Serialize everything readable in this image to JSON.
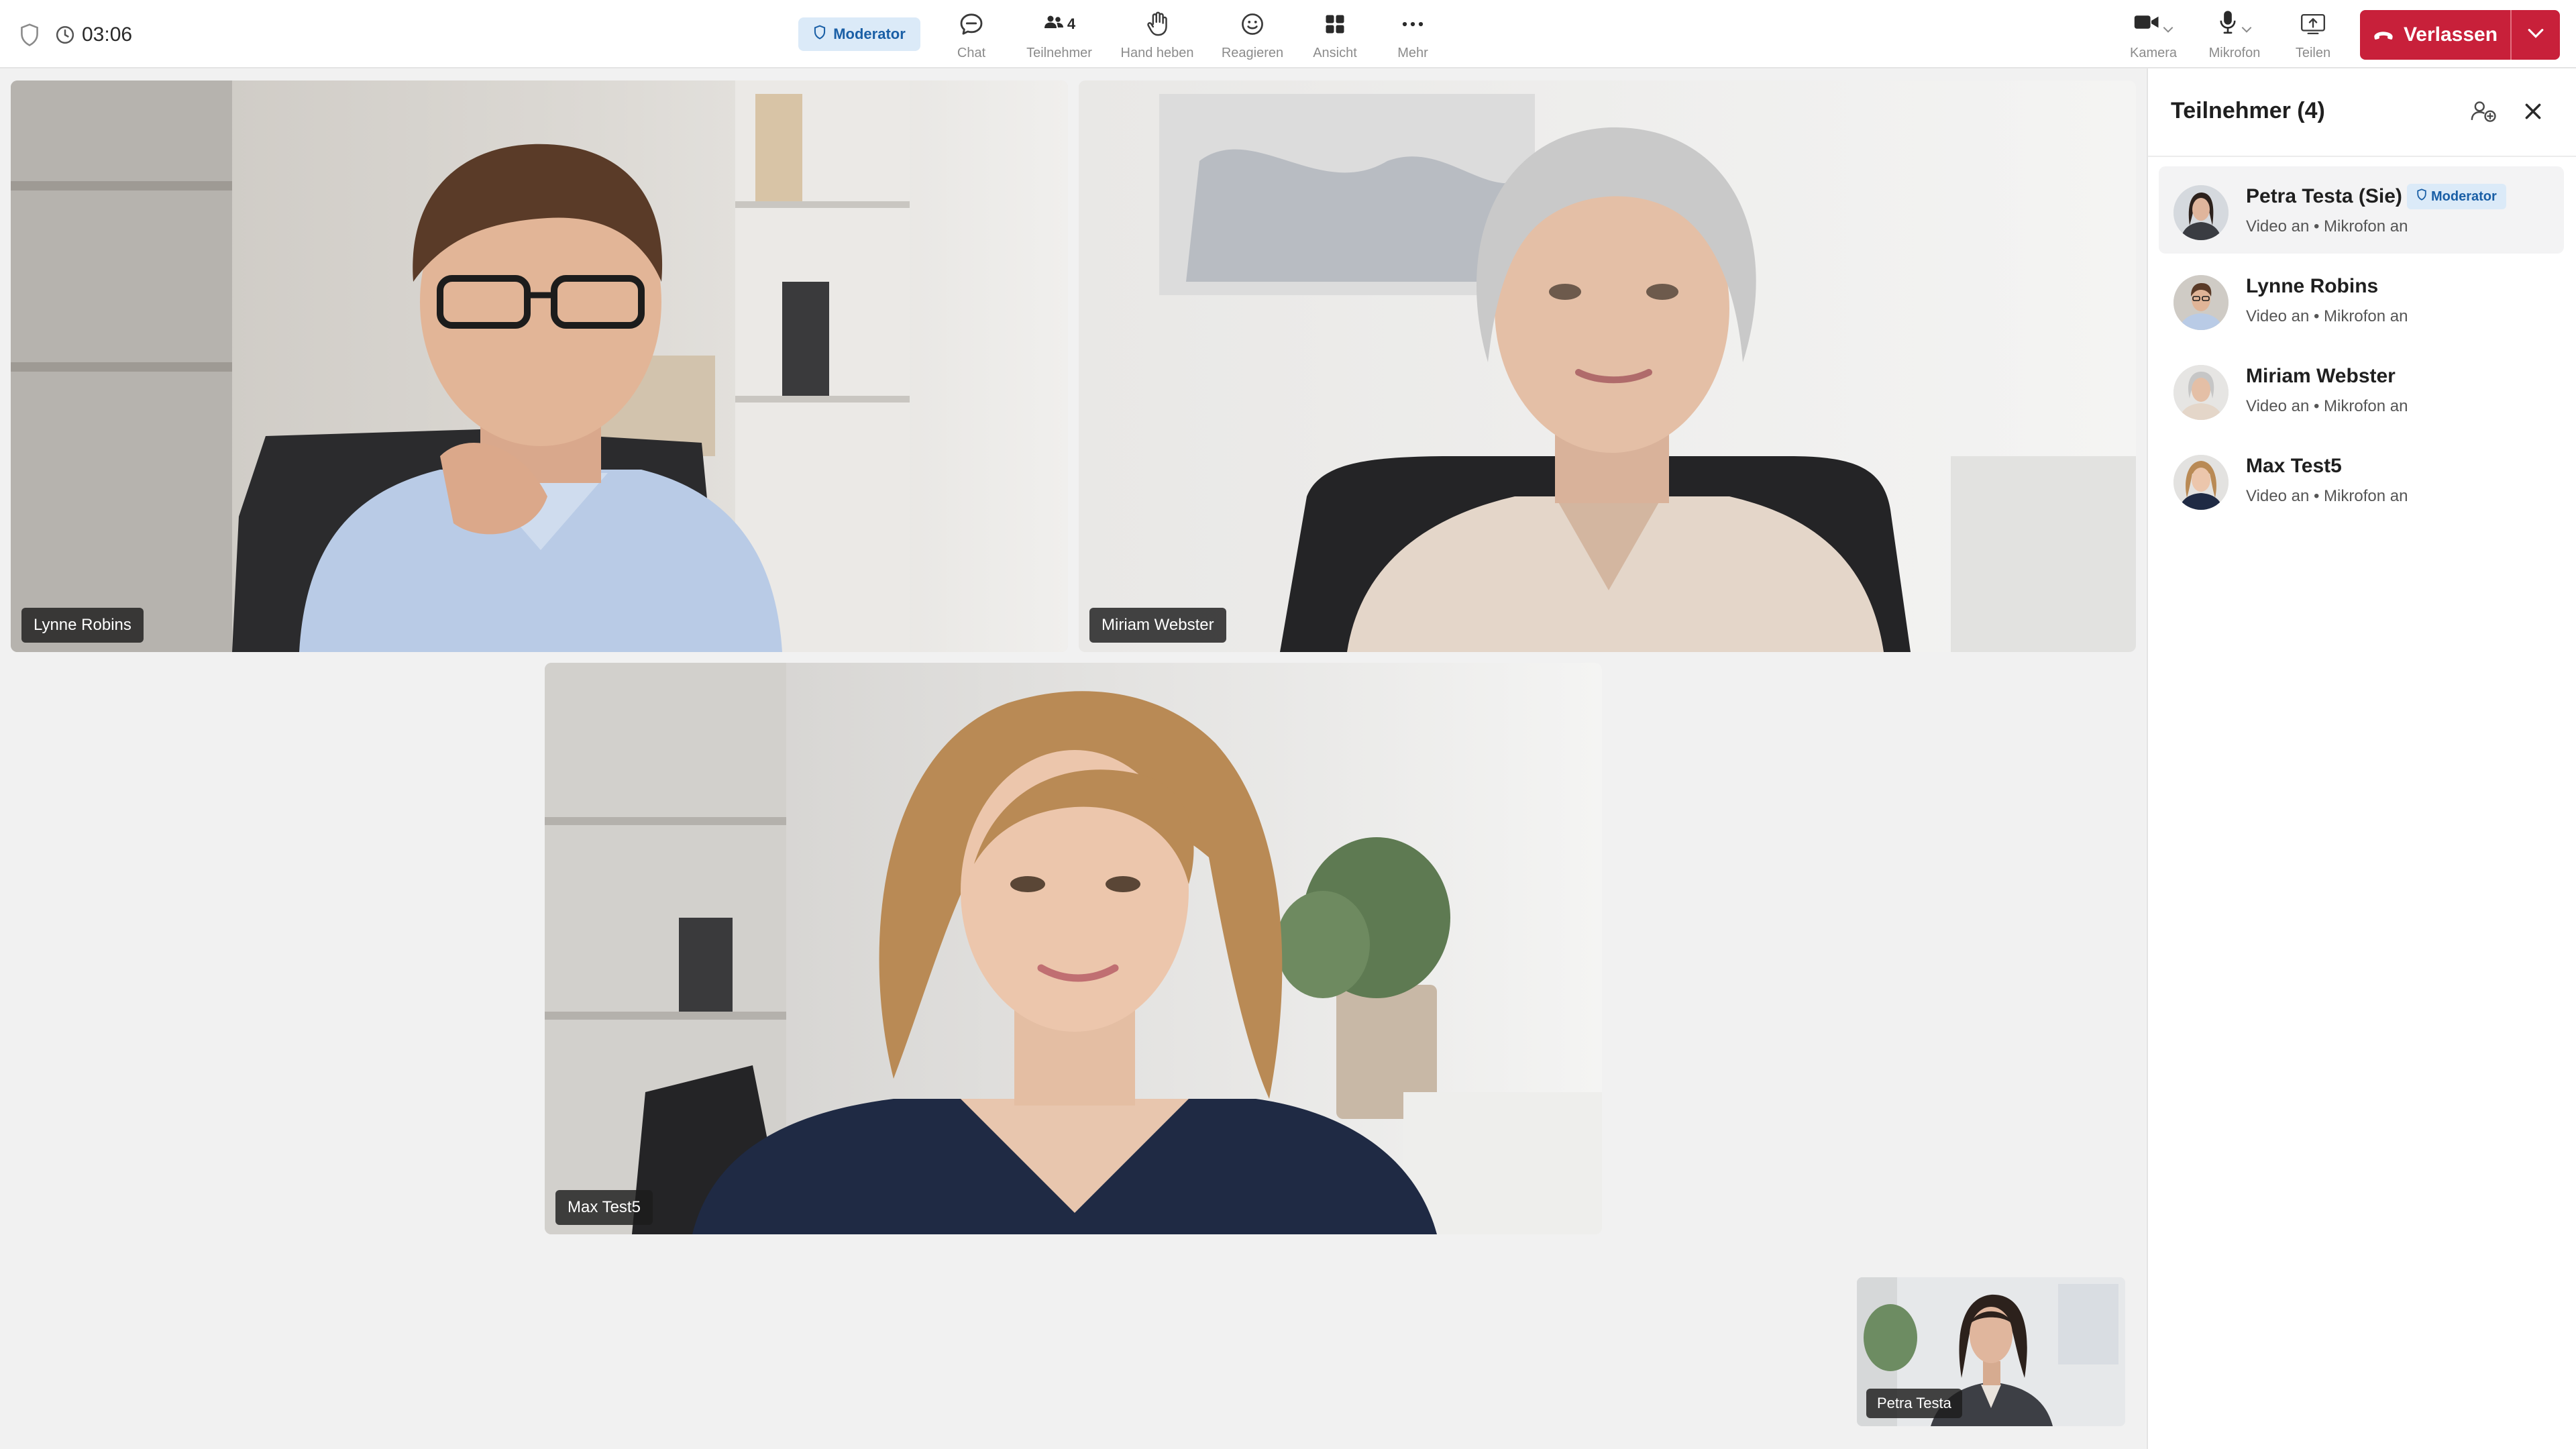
{
  "header": {
    "timer": "03:06",
    "role_badge": "Moderator",
    "toolbar": {
      "chat": "Chat",
      "participants": "Teilnehmer",
      "participants_count": "4",
      "raise_hand": "Hand heben",
      "react": "Reagieren",
      "view": "Ansicht",
      "more": "Mehr",
      "camera": "Kamera",
      "microphone": "Mikrofon",
      "share": "Teilen"
    },
    "leave_label": "Verlassen"
  },
  "tiles": {
    "lynne": "Lynne Robins",
    "miriam": "Miriam Webster",
    "max": "Max Test5",
    "self": "Petra Testa"
  },
  "panel": {
    "title": "Teilnehmer (4)",
    "participants": [
      {
        "name": "Petra Testa (Sie)",
        "badge": "Moderator",
        "status": "Video an • Mikrofon an"
      },
      {
        "name": "Lynne Robins",
        "status": "Video an • Mikrofon an"
      },
      {
        "name": "Miriam Webster",
        "status": "Video an • Mikrofon an"
      },
      {
        "name": "Max Test5",
        "status": "Video an • Mikrofon an"
      }
    ]
  },
  "colors": {
    "accent": "#1a5fa6",
    "badge_bg": "#dbeaf8",
    "leave": "#c8203a"
  }
}
